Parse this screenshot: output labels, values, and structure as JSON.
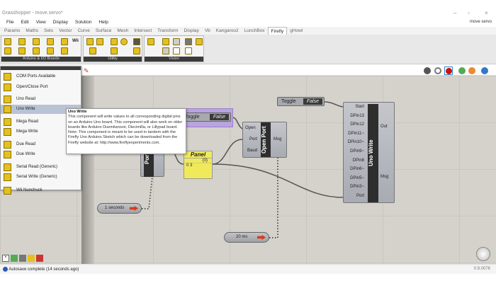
{
  "window": {
    "title": "Grasshopper - move.servo*",
    "document": "move servo"
  },
  "menu": [
    "File",
    "Edit",
    "View",
    "Display",
    "Solution",
    "Help"
  ],
  "tabs": [
    "Params",
    "Maths",
    "Sets",
    "Vector",
    "Curve",
    "Surface",
    "Mesh",
    "Intersect",
    "Transform",
    "Display",
    "Vb",
    "Kangaroo2",
    "LunchBox",
    "Firefly",
    "gHowl"
  ],
  "active_tab": "Firefly",
  "ribbon": {
    "groups": [
      {
        "label": "Arduino & I/O Boards"
      },
      {
        "label": "Utility"
      },
      {
        "label": "Vision"
      }
    ],
    "wii_label": "Wii"
  },
  "dropdown": {
    "items": [
      {
        "label": "COM Ports Available",
        "icon": "port-icon"
      },
      {
        "label": "Open/Close Port",
        "icon": "open-icon"
      },
      {
        "label": "Uno Read",
        "icon": "uno-read-icon"
      },
      {
        "label": "Uno Write",
        "icon": "uno-write-icon",
        "selected": true
      },
      {
        "label": "Mega Read",
        "icon": "mega-read-icon"
      },
      {
        "label": "Mega Write",
        "icon": "mega-write-icon"
      },
      {
        "label": "Due Read",
        "icon": "due-read-icon"
      },
      {
        "label": "Due Write",
        "icon": "due-write-icon"
      },
      {
        "label": "Serial Read (Generic)",
        "icon": "serial-read-icon"
      },
      {
        "label": "Serial Write (Generic)",
        "icon": "serial-write-icon"
      },
      {
        "label": "Wii Nunchuck",
        "icon": "wii-icon"
      }
    ]
  },
  "tooltip": {
    "title": "Uno Write",
    "body": "This component will write values to all corresponding digital pins on an Arduino Uno board.  This component will also work on older boards like Arduino Duemilanove, Diecimilla, or Lillypad board.  Note: This component is meant to be used in tandem with the Firefly Uno Arduino Sketch which can be downloaded from the Firefly website at: http://www.fireflyexperiments.com."
  },
  "canvas": {
    "toggle1": {
      "label": "Toggle",
      "value": "False"
    },
    "toggle2": {
      "label": "Toggle",
      "value": "False"
    },
    "ports": {
      "label": "Ports A"
    },
    "panel": {
      "title": "Panel",
      "path": "{0}",
      "index": "0",
      "value": "3"
    },
    "timer1": {
      "label": "1 seconds"
    },
    "timer2": {
      "label": "20 ms"
    },
    "open_port": {
      "label": "Open Port",
      "inputs": [
        "Open",
        "Port",
        "Baud"
      ],
      "outputs": [
        "Msg"
      ]
    },
    "uno_write": {
      "label": "Uno Write",
      "inputs": [
        "Start",
        "DPin13",
        "DPin12",
        "DPin11~",
        "DPin10~",
        "DPin9~",
        "DPin8",
        "DPin6~",
        "DPin5~",
        "DPin3~",
        "Port"
      ],
      "outputs": [
        "Out",
        "Msg"
      ]
    }
  },
  "status": {
    "message": "Autosave complete (14 seconds ago)",
    "version": "0.9.0076"
  },
  "colors": {
    "canvas": "#d5d2cb",
    "selection": "#b9a3e0",
    "panel": "#f0ea5a"
  }
}
